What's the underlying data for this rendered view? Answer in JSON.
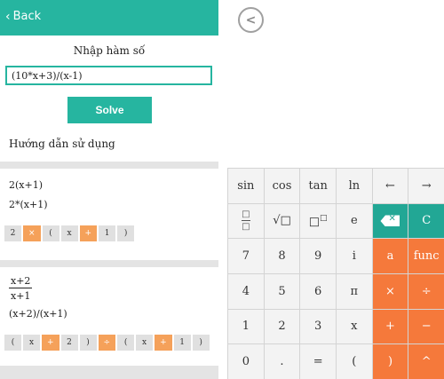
{
  "topbar": {
    "back_label": "Back"
  },
  "form": {
    "prompt": "Nhập hàm số",
    "input_value": "(10*x+3)/(x-1)",
    "solve_label": "Solve"
  },
  "guide": {
    "title": "Hướng dẫn sử dụng"
  },
  "examples": [
    {
      "line1": "2(x+1)",
      "line2": "2*(x+1)",
      "tokens": [
        "2",
        "×",
        "(",
        "x",
        "+",
        "1",
        ")"
      ]
    },
    {
      "numerator": "x+2",
      "denominator": "x+1",
      "line2": "(x+2)/(x+1)",
      "tokens": [
        "(",
        "x",
        "+",
        "2",
        ")",
        "÷",
        "(",
        "x",
        "+",
        "1",
        ")"
      ]
    }
  ],
  "keyboard": {
    "row1": [
      "sin",
      "cos",
      "tan",
      "ln",
      "←",
      "→"
    ],
    "row2": [
      "fraction",
      "√□",
      "□□",
      "e",
      "backspace",
      "C"
    ],
    "row3": [
      "7",
      "8",
      "9",
      "i",
      "a",
      "func"
    ],
    "row4": [
      "4",
      "5",
      "6",
      "π",
      "×",
      "÷"
    ],
    "row5": [
      "1",
      "2",
      "3",
      "x",
      "+",
      "−"
    ],
    "row6": [
      "0",
      ".",
      "=",
      "(",
      ")",
      "^"
    ]
  },
  "colors": {
    "accent": "#26b5a0",
    "operator": "#f5793b",
    "token_op": "#f5a15a"
  }
}
